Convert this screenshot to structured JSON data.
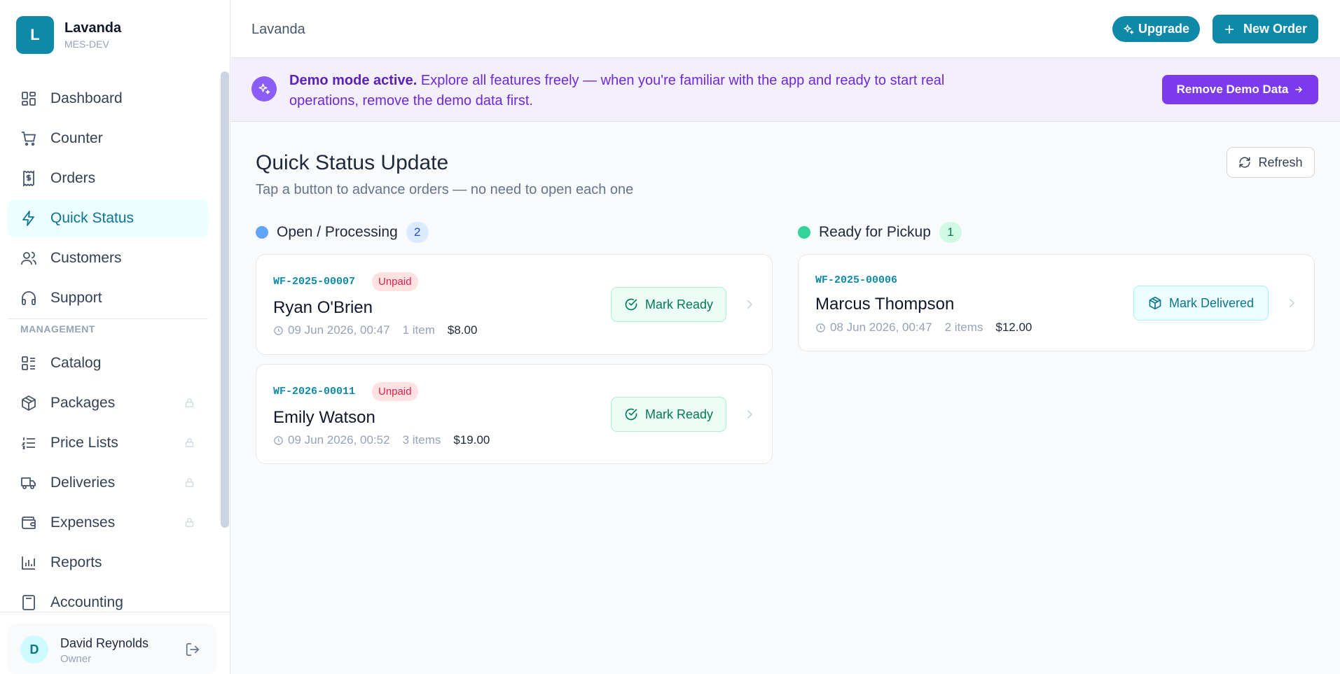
{
  "brand": {
    "initial": "L",
    "name": "Lavanda",
    "sub": "MES-DEV"
  },
  "sidebar": {
    "items": [
      {
        "label": "Dashboard",
        "icon": "dashboard-icon"
      },
      {
        "label": "Counter",
        "icon": "cart-icon"
      },
      {
        "label": "Orders",
        "icon": "receipt-icon"
      },
      {
        "label": "Quick Status",
        "icon": "lightning-icon",
        "active": true
      },
      {
        "label": "Customers",
        "icon": "users-icon"
      },
      {
        "label": "Support",
        "icon": "headphones-icon"
      }
    ],
    "section_label": "MANAGEMENT",
    "management_items": [
      {
        "label": "Catalog",
        "icon": "catalog-icon"
      },
      {
        "label": "Packages",
        "icon": "package-icon",
        "locked": true
      },
      {
        "label": "Price Lists",
        "icon": "list-icon",
        "locked": true
      },
      {
        "label": "Deliveries",
        "icon": "truck-icon",
        "locked": true
      },
      {
        "label": "Expenses",
        "icon": "wallet-icon",
        "locked": true
      },
      {
        "label": "Reports",
        "icon": "bar-chart-icon"
      },
      {
        "label": "Accounting",
        "icon": "calculator-icon"
      }
    ]
  },
  "user": {
    "initial": "D",
    "name": "David Reynolds",
    "role": "Owner"
  },
  "topbar": {
    "title": "Lavanda",
    "upgrade_label": "Upgrade",
    "new_order_label": "New Order"
  },
  "banner": {
    "strong": "Demo mode active.",
    "text": " Explore all features freely — when you're familiar with the app and ready to start real operations, remove the demo data first.",
    "button_label": "Remove Demo Data"
  },
  "page": {
    "title": "Quick Status Update",
    "subtitle": "Tap a button to advance orders — no need to open each one",
    "refresh_label": "Refresh"
  },
  "columns": {
    "open": {
      "title": "Open / Processing",
      "count": "2",
      "color": "#60a5fa",
      "orders": [
        {
          "id": "WF-2025-00007",
          "status": "Unpaid",
          "customer": "Ryan O'Brien",
          "date": "09 Jun 2026, 00:47",
          "items": "1 item",
          "amount": "$8.00",
          "action": "Mark Ready"
        },
        {
          "id": "WF-2026-00011",
          "status": "Unpaid",
          "customer": "Emily Watson",
          "date": "09 Jun 2026, 00:52",
          "items": "3 items",
          "amount": "$19.00",
          "action": "Mark Ready"
        }
      ]
    },
    "ready": {
      "title": "Ready for Pickup",
      "count": "1",
      "color": "#34d399",
      "orders": [
        {
          "id": "WF-2025-00006",
          "customer": "Marcus Thompson",
          "date": "08 Jun 2026, 00:47",
          "items": "2 items",
          "amount": "$12.00",
          "action": "Mark Delivered"
        }
      ]
    }
  }
}
